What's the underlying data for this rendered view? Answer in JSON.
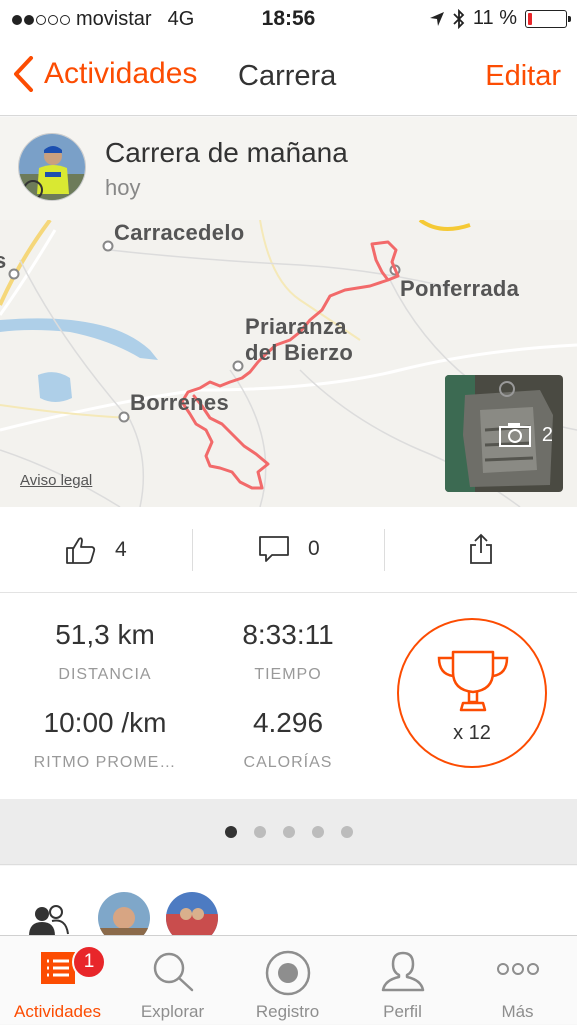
{
  "status_bar": {
    "carrier": "movistar",
    "network": "4G",
    "time": "18:56",
    "battery_percent": "11 %",
    "battery_level": 0.11,
    "signal_bars_filled": 2,
    "signal_bars_total": 5
  },
  "nav": {
    "back_label": "Actividades",
    "title": "Carrera",
    "edit_label": "Editar"
  },
  "activity": {
    "title": "Carrera de mañana",
    "date": "hoy"
  },
  "map": {
    "places": [
      "Carracedelo",
      "Ponferrada",
      "Priaranza",
      "del Bierzo",
      "Borrenes"
    ],
    "legal_link": "Aviso legal",
    "photo_count": "2"
  },
  "social": {
    "kudos_count": "4",
    "comments_count": "0"
  },
  "stats": {
    "distance_value": "51,3 km",
    "distance_label": "DISTANCIA",
    "time_value": "8:33:11",
    "time_label": "TIEMPO",
    "pace_value": "10:00 /km",
    "pace_label": "RITMO PROME…",
    "calories_value": "4.296",
    "calories_label": "CALORÍAS",
    "achievements": "x 12"
  },
  "pager": {
    "pages": 5,
    "active_index": 0
  },
  "tabs": [
    {
      "label": "Actividades",
      "icon": "activities-list-icon",
      "badge": "1"
    },
    {
      "label": "Explorar",
      "icon": "search-icon"
    },
    {
      "label": "Registro",
      "icon": "record-icon"
    },
    {
      "label": "Perfil",
      "icon": "profile-icon"
    },
    {
      "label": "Más",
      "icon": "more-icon"
    }
  ],
  "colors": {
    "accent": "#fc4c02",
    "route": "#f26a6a",
    "badge": "#e8262a"
  }
}
